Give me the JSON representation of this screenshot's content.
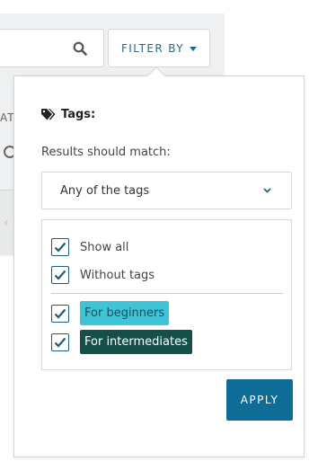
{
  "toolbar": {
    "search_value": "",
    "filter_label": "FILTER BY",
    "icons": [
      "search-icon",
      "caret-down-icon"
    ]
  },
  "background": {
    "frag_text": "AT",
    "nav_arrow": "‹"
  },
  "filter_panel": {
    "tags_heading": "Tags:",
    "match_label": "Results should match:",
    "match_select": {
      "selected": "Any of the tags"
    },
    "options": [
      {
        "label": "Show all",
        "checked": true
      },
      {
        "label": "Without tags",
        "checked": true
      }
    ],
    "tags": [
      {
        "label": "For beginners",
        "checked": true,
        "color": "#3fc3d6"
      },
      {
        "label": "For intermediates",
        "checked": true,
        "color": "#144f4a"
      }
    ],
    "apply_label": "APPLY"
  },
  "colors": {
    "accent": "#0f6c96",
    "link": "#1b6a8a"
  }
}
